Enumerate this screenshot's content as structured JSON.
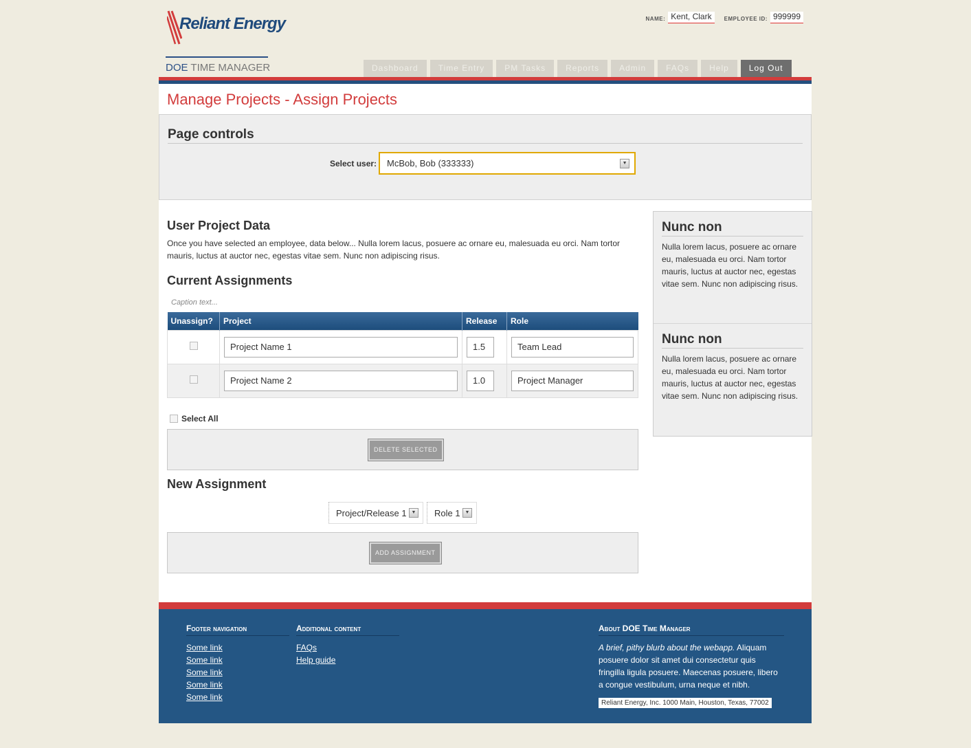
{
  "header": {
    "logo_text": "Reliant Energy",
    "name_label": "NAME:",
    "name_value": "Kent, Clark",
    "employee_label": "EMPLOYEE ID:",
    "employee_value": "999999",
    "app_title_doe": "DOE",
    "app_title_rest": "TIME MANAGER"
  },
  "nav": {
    "tabs": [
      "Dashboard",
      "Time Entry",
      "PM Tasks",
      "Reports",
      "Admin",
      "FAQs",
      "Help"
    ],
    "logout": "Log Out"
  },
  "page": {
    "title": "Manage Projects - Assign Projects",
    "controls_title": "Page controls",
    "select_user_label": "Select user:",
    "select_user_value": "McBob, Bob (333333)"
  },
  "content": {
    "user_data_title": "User Project Data",
    "intro": "Once you have selected an employee, data below... Nulla lorem lacus, posuere ac ornare eu, malesuada eu orci. Nam tortor mauris, luctus at auctor nec, egestas vitae sem. Nunc non adipiscing risus.",
    "current_title": "Current Assignments",
    "caption": "Caption text...",
    "columns": [
      "Unassign?",
      "Project",
      "Release",
      "Role"
    ],
    "rows": [
      {
        "project": "Project Name 1",
        "release": "1.5",
        "role": "Team Lead"
      },
      {
        "project": "Project Name 2",
        "release": "1.0",
        "role": "Project Manager"
      }
    ],
    "select_all": "Select All",
    "delete_button": "DELETE SELECTED",
    "new_title": "New Assignment",
    "project_select": "Project/Release 1",
    "role_select": "Role 1",
    "add_button": "ADD ASSIGNMENT"
  },
  "sidebar": {
    "sections": [
      {
        "title": "Nunc non",
        "text": "Nulla lorem lacus, posuere ac ornare eu, malesuada eu orci. Nam tortor mauris, luctus at auctor nec, egestas vitae sem. Nunc non adipiscing risus."
      },
      {
        "title": "Nunc non",
        "text": "Nulla lorem lacus, posuere ac ornare eu, malesuada eu orci. Nam tortor mauris, luctus at auctor nec, egestas vitae sem. Nunc non adipiscing risus."
      }
    ]
  },
  "footer": {
    "nav_title": "Footer navigation",
    "links": [
      "Some link",
      "Some link",
      "Some link",
      "Some link",
      "Some link"
    ],
    "additional_title": "Additional content",
    "additional_links": [
      "FAQs",
      "Help guide"
    ],
    "about_title": "About DOE Time Manager",
    "about_em": "A brief, pithy blurb about the webapp.",
    "about_text": " Aliquam posuere dolor sit amet dui consectetur quis fringilla ligula posuere. Maecenas posuere, libero a congue vestibulum, urna neque et nibh.",
    "address": "Reliant Energy, Inc. 1000 Main, Houston, Texas, 77002"
  },
  "colors": {
    "brand_blue": "#245684",
    "brand_red": "#d23c3c",
    "page_bg": "#efece0"
  }
}
